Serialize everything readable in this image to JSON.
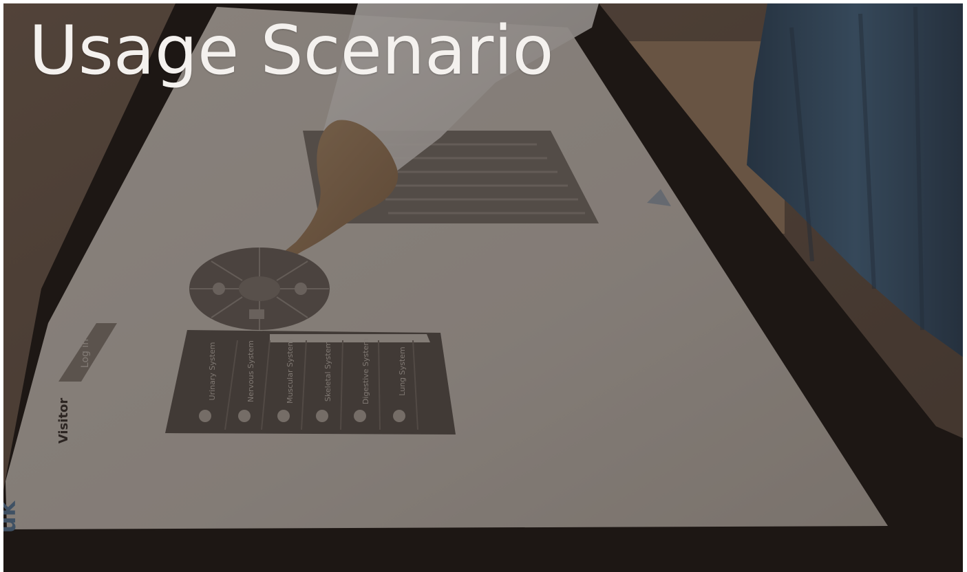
{
  "slide": {
    "title": "Usage Scenario"
  },
  "table_ui": {
    "login_label": "Log in",
    "visitor_label": "Visitor",
    "corner_logo": "uk",
    "menu_items": [
      "Urinary System",
      "Nervous System",
      "Muscular System",
      "Skeletal System",
      "Digestive System",
      "Lung System"
    ]
  },
  "colors": {
    "overlay": "#3a3330",
    "table_surface": "#cfc8c0",
    "table_frame": "#1f1a17",
    "jeans": "#3d5d7a",
    "title_text": "#f4f1ee",
    "widget_gray": "#6e6661"
  }
}
